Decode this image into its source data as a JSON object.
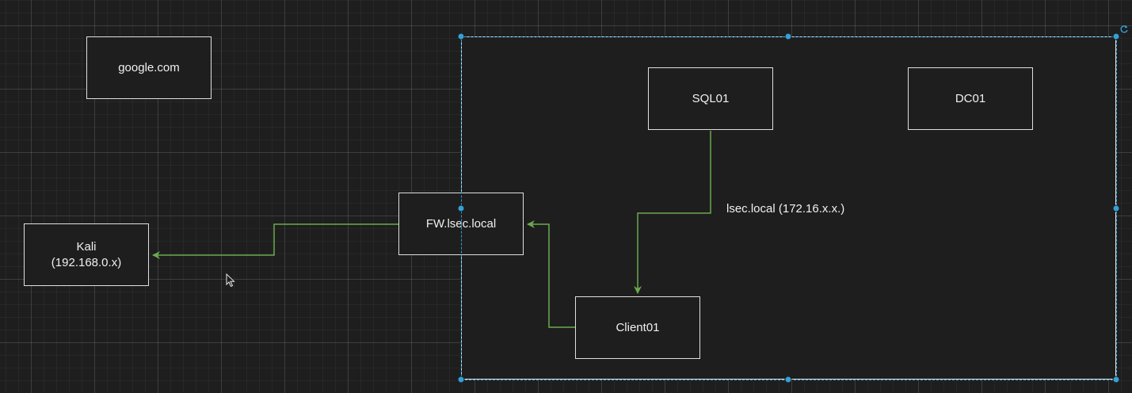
{
  "nodes": {
    "google": "google.com",
    "kali": "Kali\n(192.168.0.x)",
    "fw": "FW.lsec.local",
    "sql": "SQL01",
    "dc": "DC01",
    "client": "Client01"
  },
  "network_label": "lsec.local (172.16.x.x.)",
  "colors": {
    "background": "#1e1e1e",
    "edge": "#6aaa4e",
    "selection": "#33a0d6",
    "node_border": "#e0e0e0"
  },
  "icons": {
    "rotate": "rotate-icon",
    "cursor": "mouse-cursor-icon"
  }
}
